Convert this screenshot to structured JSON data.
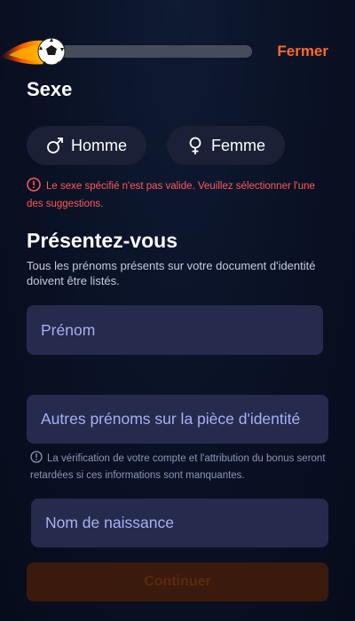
{
  "header": {
    "close_label": "Fermer",
    "progress_percent": 0
  },
  "gender": {
    "title": "Sexe",
    "male_label": "Homme",
    "female_label": "Femme",
    "error_message": "Le sexe spécifié n'est pas valide. Veuillez sélectionner l'une des suggestions."
  },
  "intro": {
    "title": "Présentez-vous",
    "subtitle": "Tous les prénoms présents sur votre document d'identité doivent être listés."
  },
  "fields": {
    "first_name_placeholder": "Prénom",
    "other_names_placeholder": "Autres prénoms sur la pièce d'identité",
    "info_message": "La vérification de votre compte et l'attribution du bonus seront retardées si ces informations sont manquantes.",
    "birth_name_placeholder": "Nom de naissance"
  },
  "actions": {
    "continue_label": "Continuer"
  },
  "colors": {
    "accent": "#ff6a2b",
    "error": "#ff5a5a",
    "field_bg": "#262b4d",
    "placeholder": "#a9aef3",
    "background": "#0a1124"
  }
}
